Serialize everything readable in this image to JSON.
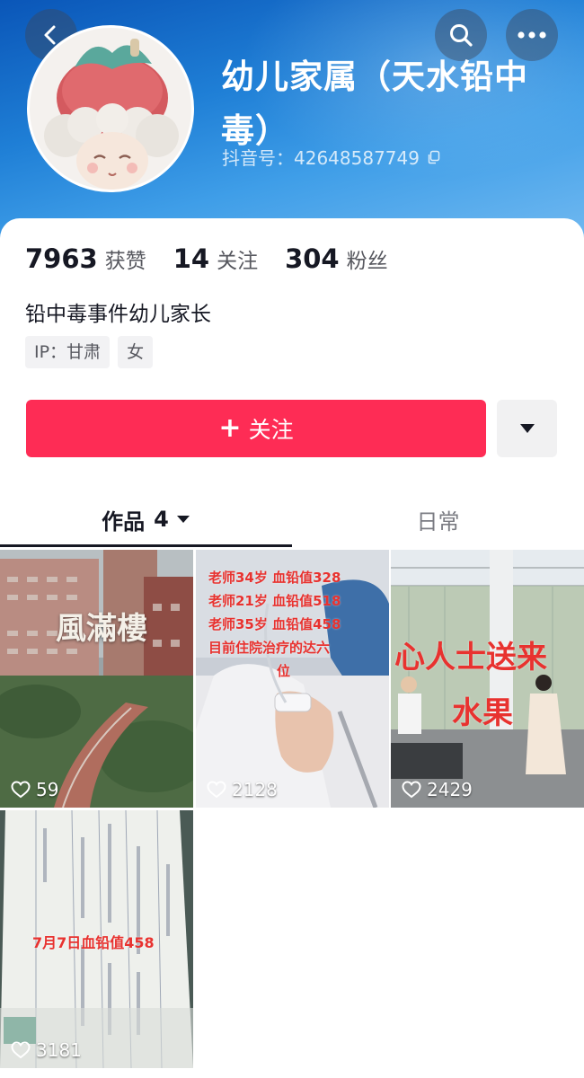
{
  "header": {
    "nickname": "幼儿家属（天水铅中毒）",
    "account_id": "抖音号：42648587749"
  },
  "icons": {
    "back": "chevron-left-icon",
    "search": "search-icon",
    "more": "more-dots-icon",
    "copy": "copy-icon",
    "dropdown": "caret-down-icon",
    "heart": "heart-outline-icon"
  },
  "stats": [
    {
      "value": "7963",
      "label": "获赞"
    },
    {
      "value": "14",
      "label": "关注"
    },
    {
      "value": "304",
      "label": "粉丝"
    }
  ],
  "bio": "铅中毒事件幼儿家长",
  "tags": [
    "IP：甘肃",
    "女"
  ],
  "follow_button": {
    "icon": "+",
    "label": "关注"
  },
  "tabs": {
    "works_label": "作品",
    "works_count": "4",
    "daily_label": "日常"
  },
  "videos": [
    {
      "likes": "59",
      "overlay": [
        "風滿樓"
      ]
    },
    {
      "likes": "2128",
      "overlay": [
        "老师34岁 血铅值328",
        "老师21岁 血铅值518",
        "老师35岁 血铅值458",
        "目前住院治疗的达六",
        "位"
      ]
    },
    {
      "likes": "2429",
      "overlay": [
        "心人士送来",
        "水果"
      ]
    },
    {
      "likes": "3181",
      "overlay": [
        "7月7日血铅值458"
      ]
    }
  ],
  "colors": {
    "follow_red": "#fe2c55",
    "header_blue": "#1f7fd6",
    "overlay_red": "#e8322f"
  }
}
